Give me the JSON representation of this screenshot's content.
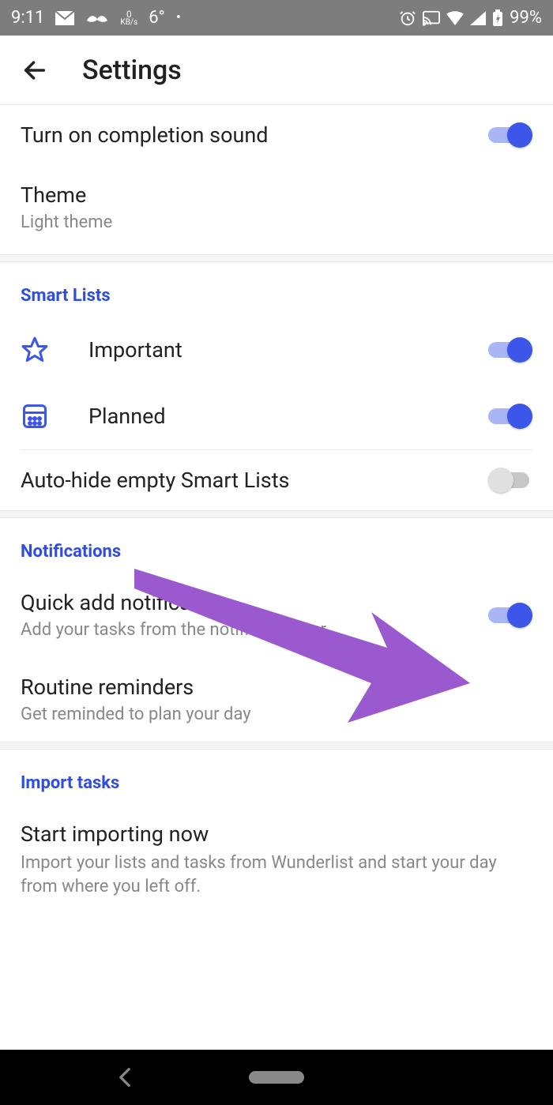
{
  "statusbar": {
    "time": "9:11",
    "kbs_value": "0",
    "kbs_label": "KB/s",
    "temp": "6°",
    "battery": "99%"
  },
  "appbar": {
    "title": "Settings"
  },
  "general": {
    "completion_sound": {
      "label": "Turn on completion sound",
      "enabled": true
    },
    "theme": {
      "label": "Theme",
      "value": "Light theme"
    }
  },
  "sections": {
    "smart_lists": {
      "header": "Smart Lists",
      "important": {
        "label": "Important",
        "enabled": true
      },
      "planned": {
        "label": "Planned",
        "enabled": true
      },
      "auto_hide": {
        "label": "Auto-hide empty Smart Lists",
        "enabled": false
      }
    },
    "notifications": {
      "header": "Notifications",
      "quick_add": {
        "label": "Quick add notification",
        "subtitle": "Add your tasks from the notification bar",
        "enabled": true
      },
      "routine": {
        "label": "Routine reminders",
        "subtitle": "Get reminded to plan your day"
      }
    },
    "import": {
      "header": "Import tasks",
      "start": {
        "label": "Start importing now",
        "subtitle": "Import your lists and tasks from Wunderlist and start your day from where you left off."
      }
    }
  },
  "colors": {
    "accent": "#3b56e8",
    "arrow": "#9b59d0"
  }
}
